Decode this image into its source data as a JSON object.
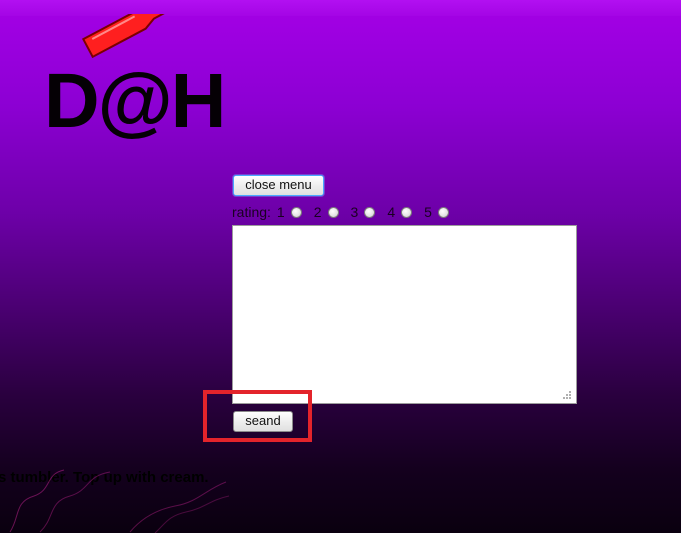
{
  "logo": {
    "text": "D@H"
  },
  "buttons": {
    "close_menu": "close menu",
    "send": "seand"
  },
  "rating": {
    "label": "rating:",
    "options": [
      "1",
      "2",
      "3",
      "4",
      "5"
    ]
  },
  "comment": {
    "value": ""
  },
  "background_text": "s tumbler. Top up with cream.",
  "colors": {
    "bg_top": "#a500e6",
    "bg_bottom": "#0a000f",
    "highlight": "#e3242b",
    "logo_accent": "#ff1f1f"
  }
}
